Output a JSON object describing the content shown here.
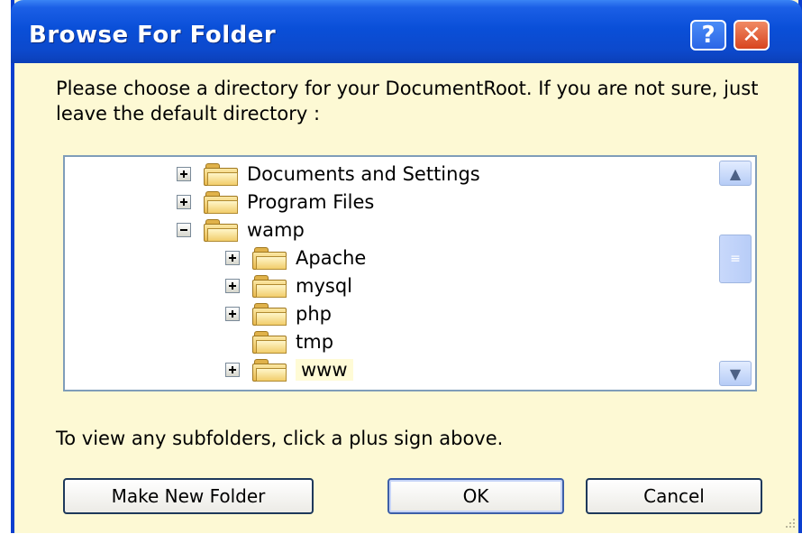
{
  "window": {
    "title": "Browse For Folder",
    "help_label": "?",
    "close_label": "✕"
  },
  "instruction": "Please choose a directory for your DocumentRoot. If you are not sure, just leave the default directory :",
  "tree": {
    "items": [
      {
        "label": "Documents and Settings",
        "expander": "plus",
        "depth": 0
      },
      {
        "label": "Program Files",
        "expander": "plus",
        "depth": 0
      },
      {
        "label": "wamp",
        "expander": "minus",
        "depth": 0
      },
      {
        "label": "Apache",
        "expander": "plus",
        "depth": 1
      },
      {
        "label": "mysql",
        "expander": "plus",
        "depth": 1
      },
      {
        "label": "php",
        "expander": "plus",
        "depth": 1
      },
      {
        "label": "tmp",
        "expander": "none",
        "depth": 1
      },
      {
        "label": "www",
        "expander": "plus",
        "depth": 1,
        "selected": true
      }
    ],
    "scroll_up_icon": "▲",
    "scroll_down_icon": "▼",
    "thumb_grip": "≡"
  },
  "hint": "To view any subfolders, click a plus sign above.",
  "buttons": {
    "make_new_folder": "Make New Folder",
    "ok": "OK",
    "cancel": "Cancel"
  },
  "colors": {
    "titlebar": "#0c49cc",
    "dialog_bg": "#fdf9d4",
    "close_button": "#d8451f"
  }
}
